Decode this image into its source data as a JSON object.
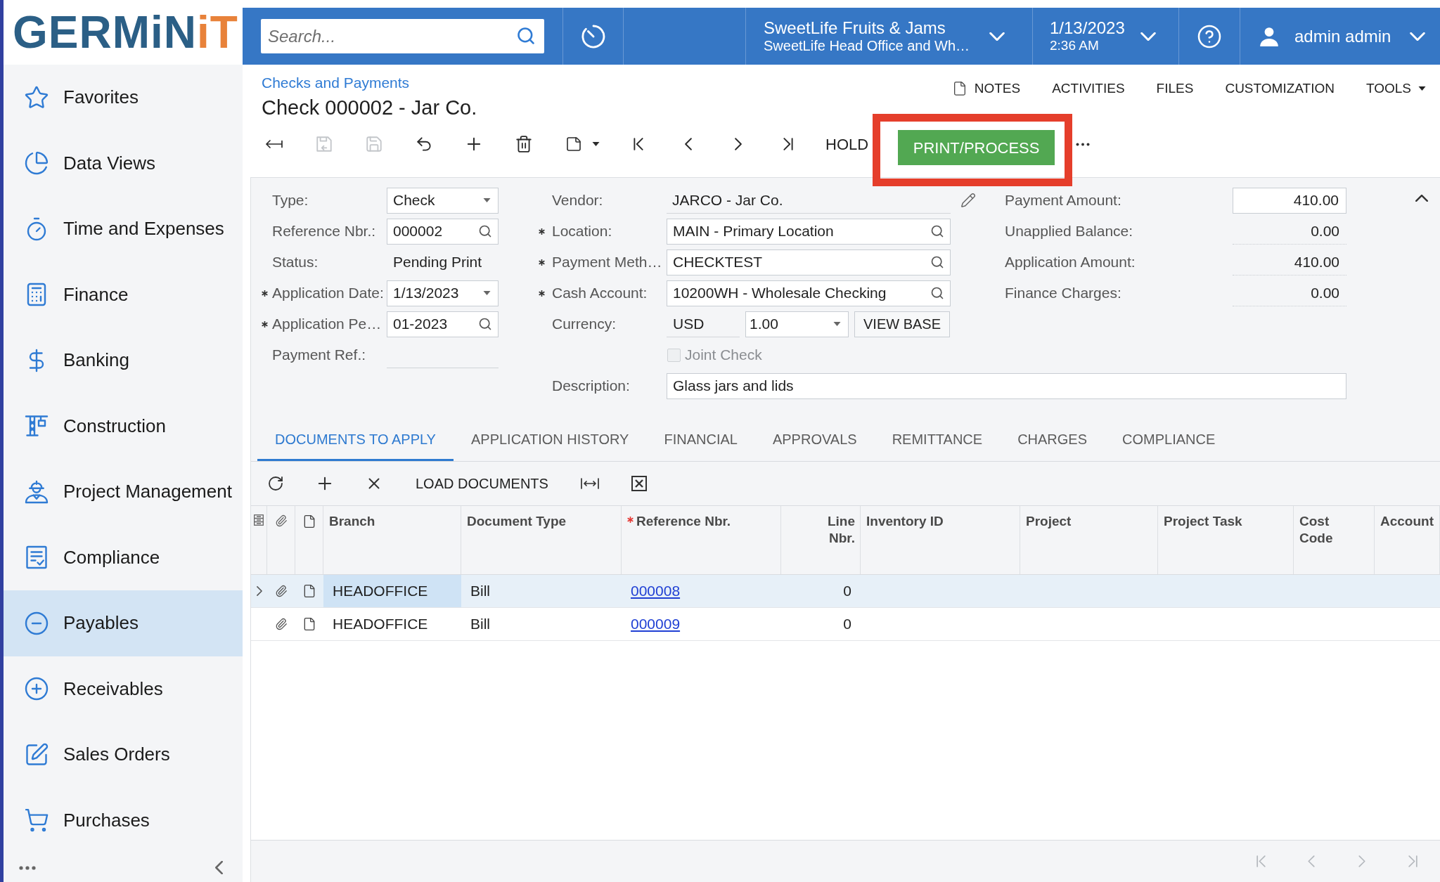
{
  "logo": {
    "parts": [
      "GERMiN",
      "iT"
    ]
  },
  "header": {
    "search": {
      "placeholder": "Search..."
    },
    "company": {
      "name": "SweetLife Fruits & Jams",
      "branch": "SweetLife Head Office and Wh…"
    },
    "datetime": {
      "date": "1/13/2023",
      "time": "2:36 AM"
    },
    "user": {
      "name": "admin admin"
    }
  },
  "sidebar": {
    "items": [
      {
        "label": "Favorites",
        "selected": false
      },
      {
        "label": "Data Views",
        "selected": false
      },
      {
        "label": "Time and Expenses",
        "selected": false
      },
      {
        "label": "Finance",
        "selected": false
      },
      {
        "label": "Banking",
        "selected": false
      },
      {
        "label": "Construction",
        "selected": false
      },
      {
        "label": "Project Management",
        "selected": false
      },
      {
        "label": "Compliance",
        "selected": false
      },
      {
        "label": "Payables",
        "selected": true
      },
      {
        "label": "Receivables",
        "selected": false
      },
      {
        "label": "Sales Orders",
        "selected": false
      },
      {
        "label": "Purchases",
        "selected": false
      }
    ]
  },
  "page": {
    "breadcrumb": "Checks and Payments",
    "title": "Check 000002 - Jar Co.",
    "links": [
      {
        "label": "NOTES",
        "kind": "icon"
      },
      {
        "label": "ACTIVITIES",
        "kind": "plain"
      },
      {
        "label": "FILES",
        "kind": "plain"
      },
      {
        "label": "CUSTOMIZATION",
        "kind": "plain"
      },
      {
        "label": "TOOLS",
        "kind": "menu"
      }
    ]
  },
  "toolbar": {
    "icon_buttons": [
      {
        "disabled": false
      },
      {
        "disabled": true
      },
      {
        "disabled": true
      },
      {
        "disabled": false
      },
      {
        "disabled": false
      },
      {
        "disabled": false
      },
      {
        "disabled": false
      },
      {
        "disabled": false
      },
      {
        "disabled": false
      },
      {
        "disabled": false
      },
      {
        "disabled": false
      }
    ],
    "actions": [
      {
        "label": "HOLD",
        "kind": "plain",
        "highlighted": false
      },
      {
        "label": "PRINT/PROCESS",
        "kind": "primary",
        "highlighted": true
      }
    ]
  },
  "form": {
    "expanded": true,
    "column_1": [
      {
        "label": "Type:",
        "required": false,
        "kind": "select",
        "value": "Check"
      },
      {
        "label": "Reference Nbr.:",
        "required": false,
        "kind": "lookup",
        "value": "000002"
      },
      {
        "label": "Status:",
        "required": false,
        "kind": "plain",
        "value": "Pending Print"
      },
      {
        "label": "Application Date:",
        "required": true,
        "kind": "select",
        "value": "1/13/2023"
      },
      {
        "label": "Application Pe…",
        "required": true,
        "kind": "lookup",
        "value": "01-2023"
      },
      {
        "label": "Payment Ref.:",
        "required": false,
        "kind": "blank"
      }
    ],
    "column_2": [
      {
        "label": "Vendor:",
        "required": false,
        "kind": "editable",
        "value": "JARCO - Jar Co."
      },
      {
        "label": "Location:",
        "required": true,
        "kind": "lookup",
        "value": "MAIN - Primary Location"
      },
      {
        "label": "Payment Meth…",
        "required": true,
        "kind": "lookup",
        "value": "CHECKTEST"
      },
      {
        "label": "Cash Account:",
        "required": true,
        "kind": "lookup",
        "value": "10200WH - Wholesale Checking"
      },
      {
        "label": "Currency:",
        "required": false,
        "kind": "currency",
        "value": "USD",
        "rate": "1.00",
        "button": "VIEW BASE"
      },
      {
        "label": "Joint Check",
        "required": false,
        "kind": "checkbox",
        "checked": false,
        "disabled": true
      }
    ],
    "column_3": [
      {
        "label": "Payment Amount:",
        "required": false,
        "kind": "input",
        "value": "410.00"
      },
      {
        "label": "Unapplied Balance:",
        "required": false,
        "kind": "readonly",
        "value": "0.00"
      },
      {
        "label": "Application Amount:",
        "required": false,
        "kind": "readonly",
        "value": "410.00"
      },
      {
        "label": "Finance Charges:",
        "required": false,
        "kind": "readonly",
        "value": "0.00"
      }
    ],
    "description": {
      "label": "Description:",
      "value": "Glass jars and lids"
    }
  },
  "tabs": [
    {
      "label": "DOCUMENTS TO APPLY",
      "selected": true
    },
    {
      "label": "APPLICATION HISTORY",
      "selected": false
    },
    {
      "label": "FINANCIAL",
      "selected": false
    },
    {
      "label": "APPROVALS",
      "selected": false
    },
    {
      "label": "REMITTANCE",
      "selected": false
    },
    {
      "label": "CHARGES",
      "selected": false
    },
    {
      "label": "COMPLIANCE",
      "selected": false
    }
  ],
  "grid": {
    "toolbar": {
      "button": "LOAD DOCUMENTS"
    },
    "columns": [
      {
        "label": "Branch",
        "kind": "text",
        "required": false
      },
      {
        "label": "Document Type",
        "kind": "text",
        "required": false
      },
      {
        "label": "Reference Nbr.",
        "kind": "link",
        "required": true
      },
      {
        "label": "Line Nbr.",
        "kind": "number",
        "required": false
      },
      {
        "label": "Inventory ID",
        "kind": "text",
        "required": false
      },
      {
        "label": "Project",
        "kind": "text",
        "required": false
      },
      {
        "label": "Project Task",
        "kind": "text",
        "required": false
      },
      {
        "label": "Cost Code",
        "kind": "text",
        "required": false
      },
      {
        "label": "Account",
        "kind": "text",
        "required": false
      }
    ],
    "rows": [
      {
        "selected": true,
        "cells": [
          "HEADOFFICE",
          "Bill",
          "000008",
          "0"
        ]
      },
      {
        "selected": false,
        "cells": [
          "HEADOFFICE",
          "Bill",
          "000009",
          "0"
        ]
      }
    ],
    "pager": {
      "disabled": true
    }
  }
}
